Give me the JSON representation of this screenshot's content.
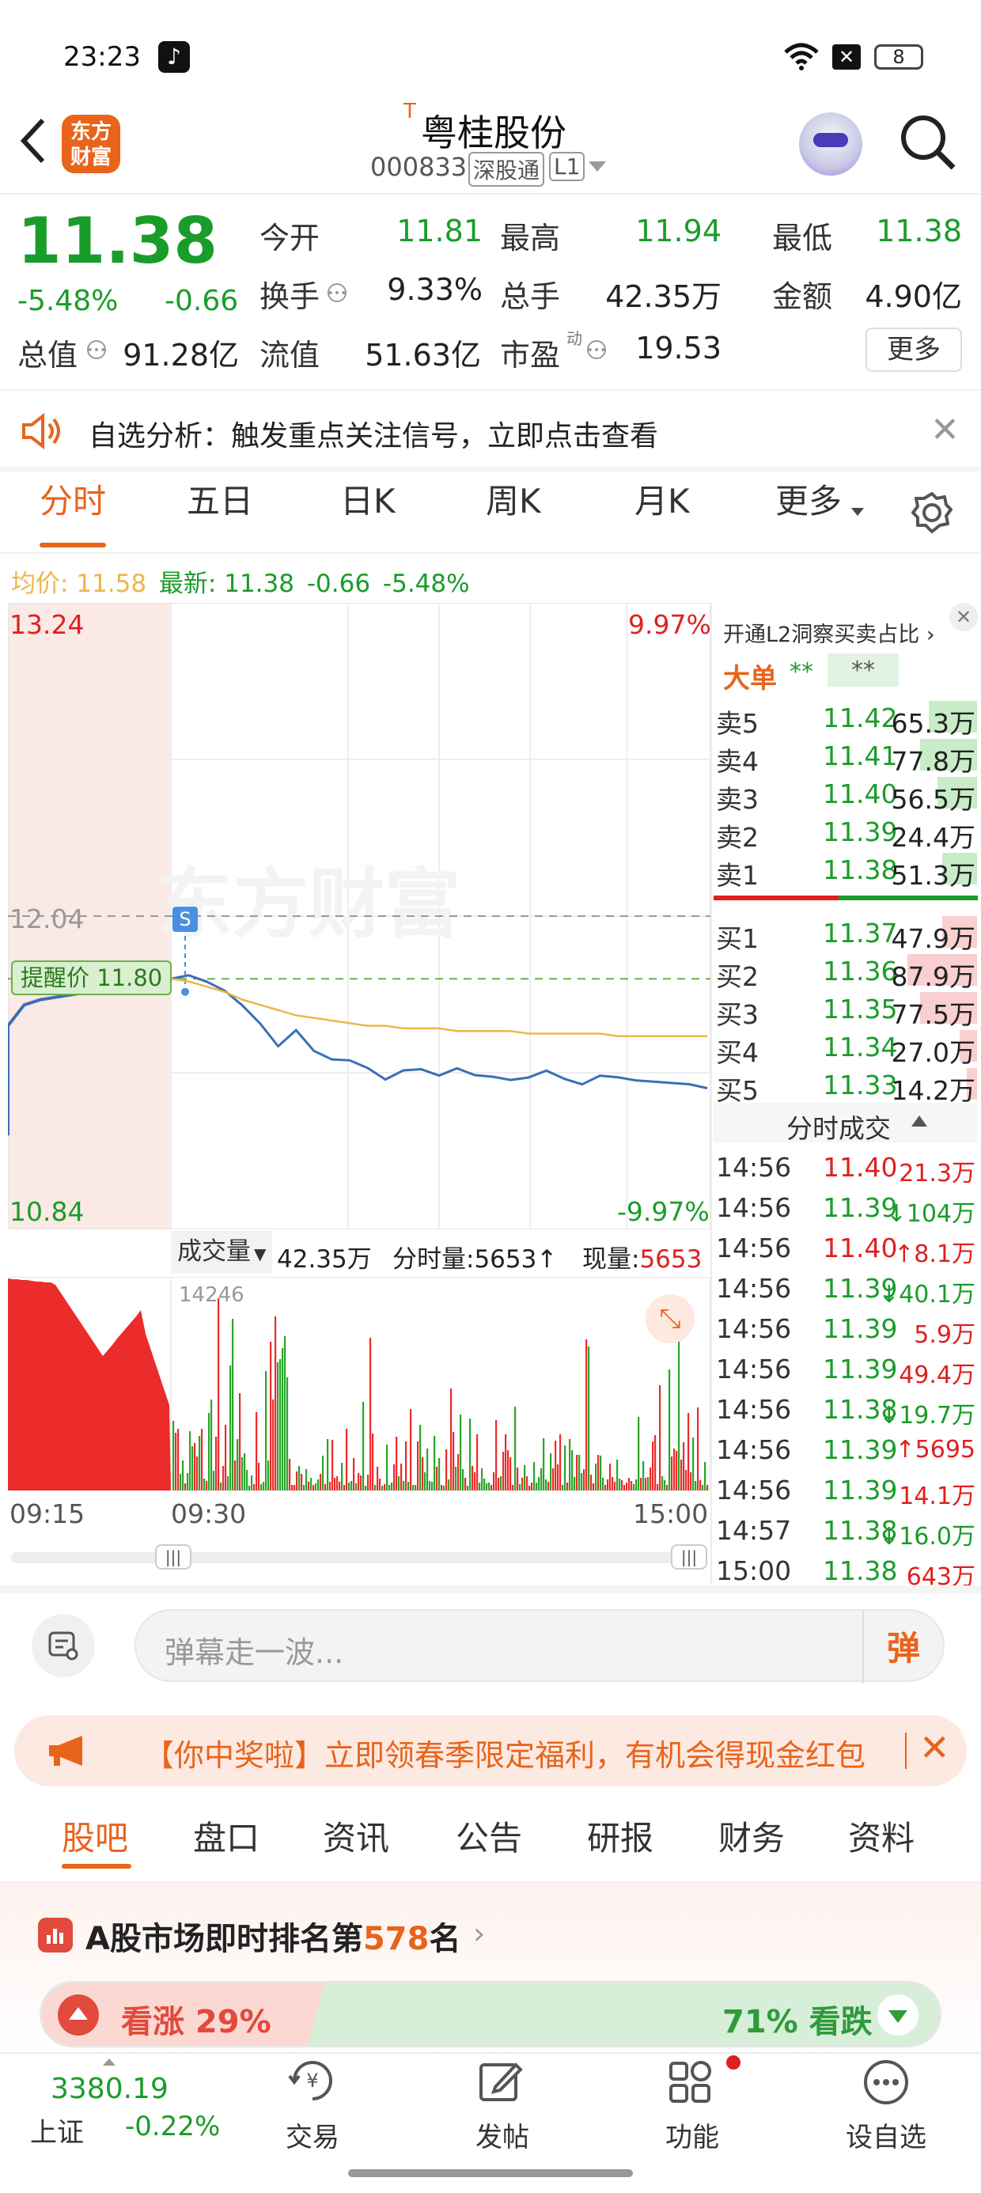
{
  "status_bar": {
    "time": "23:23",
    "battery": "8"
  },
  "header": {
    "title_prefix": "T",
    "title": "粤桂股份",
    "code": "000833",
    "exchange_badge": "深股通",
    "level_badge": "L1",
    "brand_logo": "东方\n财富"
  },
  "quote": {
    "price": "11.38",
    "change_pct": "-5.48%",
    "change": "-0.66",
    "fields": [
      {
        "label": "今开",
        "value": "11.81",
        "color": "#1a9c2a"
      },
      {
        "label": "最高",
        "value": "11.94",
        "color": "#1a9c2a"
      },
      {
        "label": "最低",
        "value": "11.38",
        "color": "#1a9c2a"
      },
      {
        "label": "换手",
        "value": "9.33%",
        "color": "#222222"
      },
      {
        "label": "总手",
        "value": "42.35万",
        "color": "#222222"
      },
      {
        "label": "金额",
        "value": "4.90亿",
        "color": "#222222"
      },
      {
        "label": "总值",
        "value": "91.28亿",
        "color": "#222222"
      },
      {
        "label": "流值",
        "value": "51.63亿",
        "color": "#222222"
      },
      {
        "label": "市盈",
        "value": "19.53",
        "color": "#222222"
      }
    ],
    "pe_sup": "动",
    "more_button": "更多"
  },
  "notice": {
    "text": "自选分析：触发重点关注信号，立即点击查看"
  },
  "chart_tabs": [
    "分时",
    "五日",
    "日K",
    "周K",
    "月K",
    "更多"
  ],
  "chart_tab_active": "分时",
  "avg_line": {
    "avg_label": "均价:",
    "avg_value": "11.58",
    "latest_label": "最新:",
    "latest_value": "11.38",
    "latest_change": "-0.66",
    "latest_pct": "-5.48%"
  },
  "chart_data": {
    "type": "line",
    "y_top_label": "13.24",
    "y_mid_label": "12.04",
    "y_bottom_label": "10.84",
    "pct_top_label": "9.97%",
    "pct_bottom_label": "-9.97%",
    "ylim": [
      10.84,
      13.24
    ],
    "alert_label": "提醒价 11.80",
    "alert_value": 11.8,
    "s_marker": "S",
    "watermark": "东方财富",
    "series": [
      {
        "name": "",
        "color": "#3a6fb5",
        "values": [
          11.8,
          11.82,
          11.78,
          11.76,
          11.7,
          11.62,
          11.55,
          11.6,
          11.52,
          11.5,
          11.48,
          11.46,
          11.42,
          11.44,
          11.46,
          11.43,
          11.45,
          11.44,
          11.42,
          11.41,
          11.43,
          11.44,
          11.42,
          11.4,
          11.42,
          11.43,
          11.41,
          11.4,
          11.41,
          11.39,
          11.38
        ]
      },
      {
        "name": "",
        "color": "#e8b84a",
        "values": [
          11.8,
          11.79,
          11.77,
          11.75,
          11.72,
          11.7,
          11.68,
          11.66,
          11.65,
          11.64,
          11.63,
          11.62,
          11.62,
          11.61,
          11.61,
          11.61,
          11.6,
          11.6,
          11.6,
          11.6,
          11.59,
          11.59,
          11.59,
          11.59,
          11.59,
          11.58,
          11.58,
          11.58,
          11.58,
          11.58,
          11.58
        ]
      }
    ],
    "auction_values": [
      11.62,
      11.7,
      11.72,
      11.73,
      11.74,
      11.75,
      11.76,
      11.77,
      11.77,
      11.78,
      11.8
    ],
    "x_labels": [
      "09:15",
      "09:30",
      "15:00"
    ],
    "volume_label": "成交量",
    "volume_total": "42.35万",
    "minute_volume": "分时量:5653",
    "current_volume_label": "现量:",
    "current_volume": "5653",
    "volume_max_label": "14246"
  },
  "order_book": {
    "promo": "开通L2洞察买卖占比",
    "big_order_label": "大单",
    "big_order_a": "**",
    "big_order_b": "**",
    "asks": [
      {
        "label": "卖5",
        "price": "11.42",
        "vol": "65.3万",
        "bar": 0.55
      },
      {
        "label": "卖4",
        "price": "11.41",
        "vol": "77.8万",
        "bar": 0.65
      },
      {
        "label": "卖3",
        "price": "11.40",
        "vol": "56.5万",
        "bar": 0.45
      },
      {
        "label": "卖2",
        "price": "11.39",
        "vol": "24.4万",
        "bar": 0.0
      },
      {
        "label": "卖1",
        "price": "11.38",
        "vol": "51.3万",
        "bar": 0.4
      }
    ],
    "bids": [
      {
        "label": "买1",
        "price": "11.37",
        "vol": "47.9万",
        "bar": 0.4
      },
      {
        "label": "买2",
        "price": "11.36",
        "vol": "87.9万",
        "bar": 0.8
      },
      {
        "label": "买3",
        "price": "11.35",
        "vol": "77.5万",
        "bar": 0.65
      },
      {
        "label": "买4",
        "price": "11.34",
        "vol": "27.0万",
        "bar": 0.2
      },
      {
        "label": "买5",
        "price": "11.33",
        "vol": "14.2万",
        "bar": 0.12
      }
    ],
    "trades_header": "分时成交",
    "trades": [
      {
        "t": "14:56",
        "p": "11.40",
        "v": "21.3万",
        "dir": "",
        "color": "#e02020"
      },
      {
        "t": "14:56",
        "p": "11.39",
        "v": "104万",
        "dir": "↓",
        "color": "#1a9c2a"
      },
      {
        "t": "14:56",
        "p": "11.40",
        "v": "8.1万",
        "dir": "↑",
        "color": "#e02020"
      },
      {
        "t": "14:56",
        "p": "11.39",
        "v": "40.1万",
        "dir": "↓",
        "color": "#1a9c2a"
      },
      {
        "t": "14:56",
        "p": "11.39",
        "v": "5.9万",
        "dir": "",
        "color": "#e02020"
      },
      {
        "t": "14:56",
        "p": "11.39",
        "v": "49.4万",
        "dir": "",
        "color": "#e02020"
      },
      {
        "t": "14:56",
        "p": "11.38",
        "v": "19.7万",
        "dir": "↓",
        "color": "#1a9c2a"
      },
      {
        "t": "14:56",
        "p": "11.39",
        "v": "5695",
        "dir": "↑",
        "color": "#e02020"
      },
      {
        "t": "14:56",
        "p": "11.39",
        "v": "14.1万",
        "dir": "",
        "color": "#e02020"
      },
      {
        "t": "14:57",
        "p": "11.38",
        "v": "16.0万",
        "dir": "↓",
        "color": "#1a9c2a"
      },
      {
        "t": "15:00",
        "p": "11.38",
        "v": "643万",
        "dir": "",
        "color": "#e02020"
      }
    ]
  },
  "comment_bar": {
    "placeholder": "弹幕走一波...",
    "danmu_button": "弹"
  },
  "promo_banner": {
    "text": "【你中奖啦】立即领春季限定福利，有机会得现金红包"
  },
  "feature_tabs": [
    "股吧",
    "盘口",
    "资讯",
    "公告",
    "研报",
    "财务",
    "资料"
  ],
  "feature_tab_active": "股吧",
  "ranking": {
    "prefix": "A股市场即时排名第",
    "rank": "578",
    "suffix": "名"
  },
  "sentiment": {
    "up_label": "看涨 29%",
    "down_label": "71% 看跌",
    "up_fraction": 0.29
  },
  "bottom_nav": {
    "index_value": "3380.19",
    "index_name": "上证",
    "index_change": "-0.22%",
    "items": [
      "交易",
      "发帖",
      "功能",
      "设自选"
    ]
  }
}
